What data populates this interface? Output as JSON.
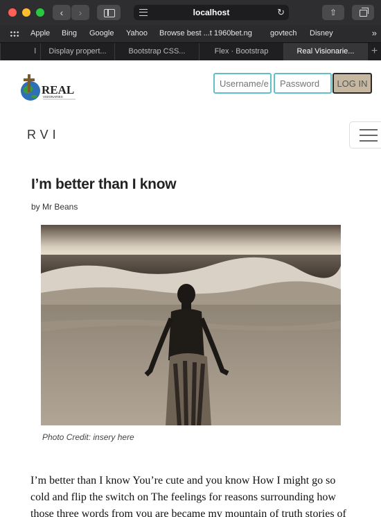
{
  "browser": {
    "url": "localhost",
    "bookmarks": [
      "Apple",
      "Bing",
      "Google",
      "Yahoo",
      "Browse best ...t 1960bet.ng",
      "govtech",
      "Disney"
    ],
    "tabs": [
      "l",
      "Display propert...",
      "Bootstrap CSS...",
      "Flex · Bootstrap",
      "Real Visionarie..."
    ],
    "active_tab_index": 4
  },
  "header": {
    "logo_text": "REAL",
    "logo_subtext": "VISIONARIES",
    "username_placeholder": "Username/e",
    "password_placeholder": "Password",
    "login_label": "LOG IN"
  },
  "navbar": {
    "brand": "RVI"
  },
  "post": {
    "title": "I’m better than I know",
    "author": "by Mr Beans",
    "photo_credit": "Photo Credit: insery here",
    "body": "I’m better than I know You’re cute and you know How I might go so cold and flip the switch on The feelings for reasons surrounding how those three words from you are became my mountain of truth stories of"
  },
  "colors": {
    "input_border": "#5fc1c8",
    "login_bg": "#c6b7a0"
  }
}
